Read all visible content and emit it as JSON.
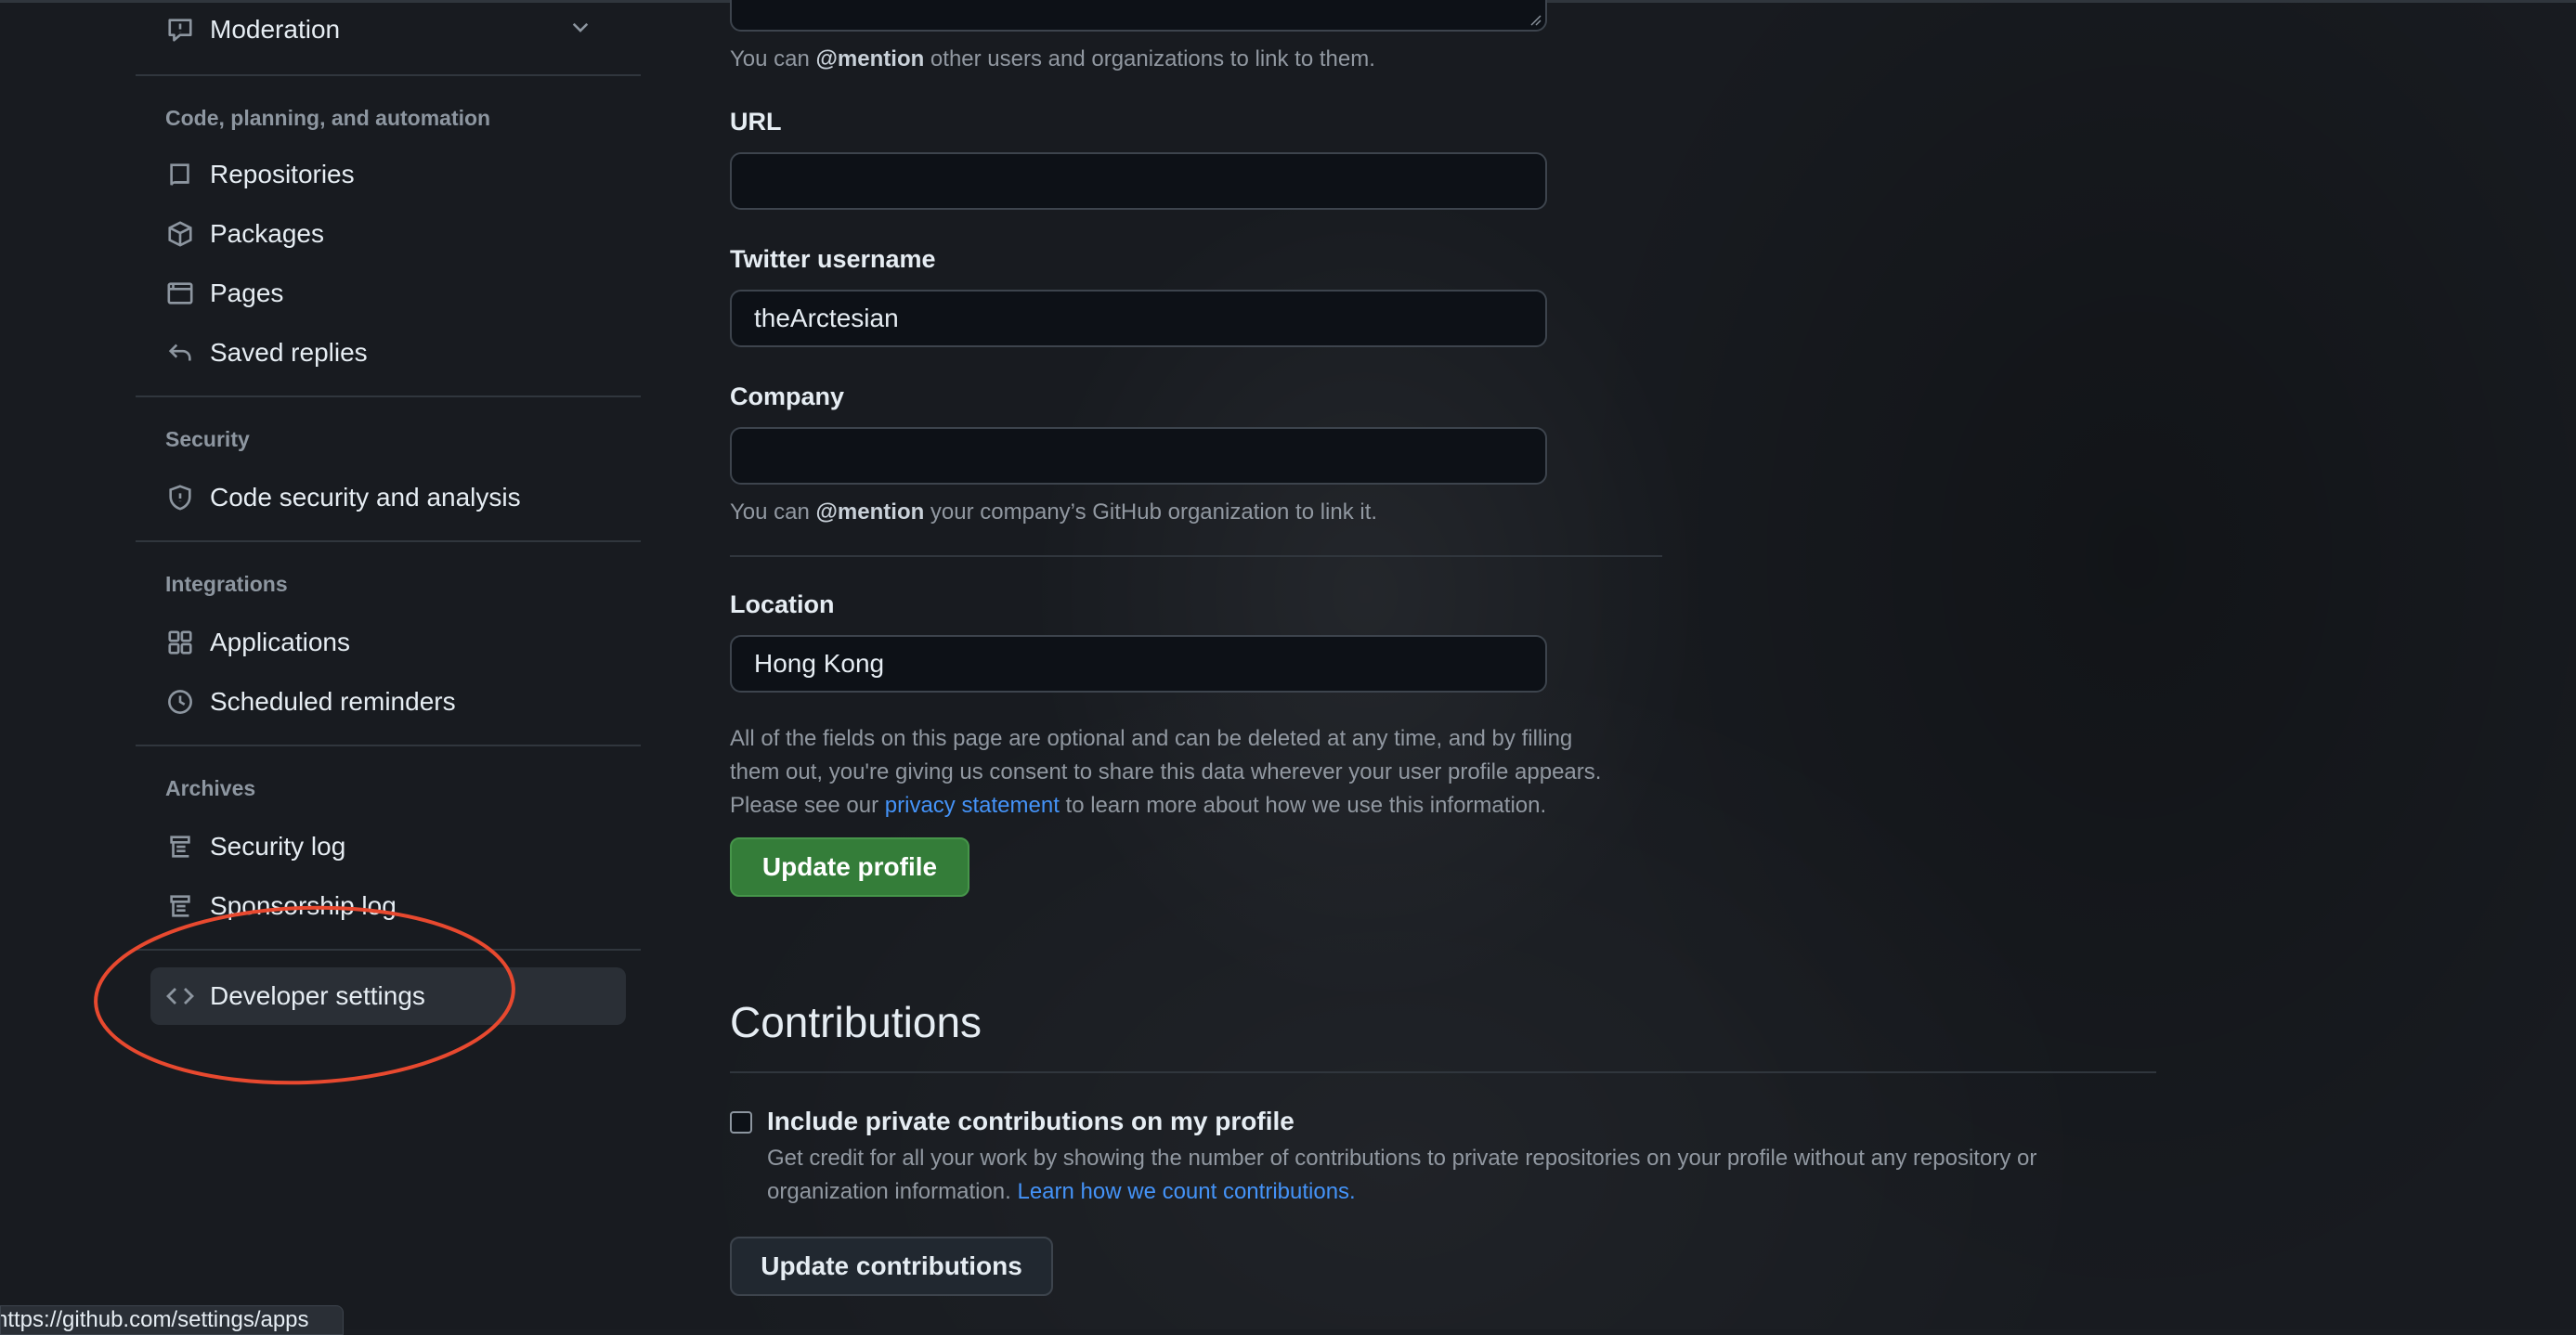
{
  "sidebar": {
    "moderation": "Moderation",
    "section_code": "Code, planning, and automation",
    "repositories": "Repositories",
    "packages": "Packages",
    "pages": "Pages",
    "saved_replies": "Saved replies",
    "section_security": "Security",
    "code_security": "Code security and analysis",
    "section_integrations": "Integrations",
    "applications": "Applications",
    "scheduled_reminders": "Scheduled reminders",
    "section_archives": "Archives",
    "security_log": "Security log",
    "sponsorship_log": "Sponsorship log",
    "developer_settings": "Developer settings"
  },
  "profile": {
    "bio_note_pre": "You can ",
    "bio_note_mention": "@mention",
    "bio_note_post": " other users and organizations to link to them.",
    "url_label": "URL",
    "url_value": "",
    "twitter_label": "Twitter username",
    "twitter_value": "theArctesian",
    "company_label": "Company",
    "company_value": "",
    "company_note_pre": "You can ",
    "company_note_mention": "@mention",
    "company_note_post": " your company’s GitHub organization to link it.",
    "location_label": "Location",
    "location_value": "Hong Kong",
    "optional_note_1": "All of the fields on this page are optional and can be deleted at any time, and by filling",
    "optional_note_2": "them out, you're giving us consent to share this data wherever your user profile appears.",
    "optional_note_3_pre": "Please see our ",
    "optional_note_3_link": "privacy statement",
    "optional_note_3_post": " to learn more about how we use this information.",
    "update_button": "Update profile"
  },
  "contributions": {
    "heading": "Contributions",
    "checkbox_label": "Include private contributions on my profile",
    "checked": false,
    "desc_1": "Get credit for all your work by showing the number of contributions to private repositories on your profile without any repository or",
    "desc_2_pre": "organization information. ",
    "desc_2_link": "Learn how we count contributions.",
    "update_button": "Update contributions"
  },
  "status_bar": {
    "url": "https://github.com/settings/apps"
  },
  "colors": {
    "accent_link": "#4493f8",
    "primary_button": "#347d39",
    "annotation": "#e8492f"
  }
}
